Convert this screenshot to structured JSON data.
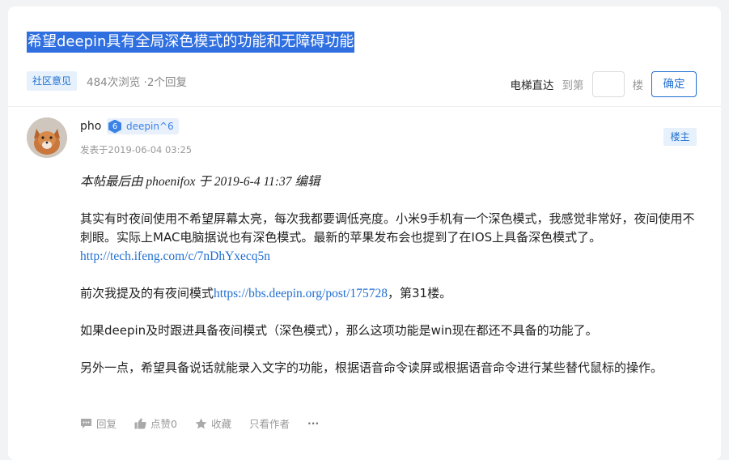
{
  "topic": {
    "title": "希望deepin具有全局深色模式的功能和无障碍功能",
    "category": "社区意见",
    "stats": "484次浏览 ·2个回复"
  },
  "elevator": {
    "label": "电梯直达",
    "prefix": "到第",
    "suffix": "楼",
    "floor_value": "",
    "button": "确定"
  },
  "post": {
    "author": "pho",
    "level_num": "6",
    "level_name": "deepin^6",
    "date": "发表于2019-06-04 03:25",
    "op_badge": "楼主",
    "edit_note": "本帖最后由 phoenifox 于 2019-6-4 11:37 编辑",
    "para1": "其实有时夜间使用不希望屏幕太亮，每次我都要调低亮度。小米9手机有一个深色模式，我感觉非常好，夜间使用不刺眼。实际上MAC电脑据说也有深色模式。最新的苹果发布会也提到了在IOS上具备深色模式了。",
    "link1": "http://tech.ifeng.com/c/7nDhYxecq5n",
    "para2_before": "前次我提及的有夜间模式",
    "link2": "https://bbs.deepin.org/post/175728",
    "para2_after": "，第31楼。",
    "para3": "如果deepin及时跟进具备夜间模式（深色模式），那么这项功能是win现在都还不具备的功能了。",
    "para4": "另外一点，希望具备说话就能录入文字的功能，根据语音命令读屏或根据语音命令进行某些替代鼠标的操作。"
  },
  "actions": {
    "reply": "回复",
    "like": "点赞0",
    "favorite": "收藏",
    "author_only": "只看作者",
    "more": "···"
  },
  "colors": {
    "accent": "#1f6fd1",
    "title_highlight": "#2f6fe0"
  }
}
